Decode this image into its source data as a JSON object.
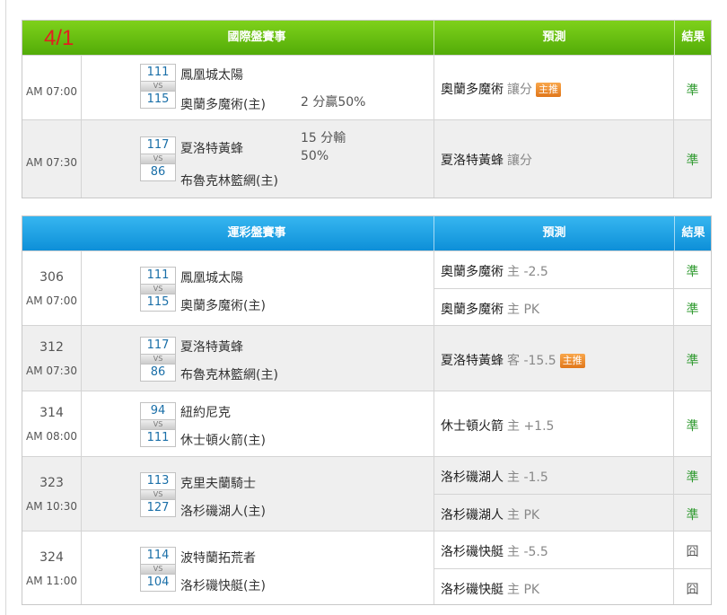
{
  "date_mark": "4/1",
  "colors": {
    "intl_header": "#5eb80e",
    "sports_header": "#1a9ee0",
    "badge": "#ef8a2c",
    "correct": "#2f9a2f",
    "score": "#1a6fa8",
    "date_mark": "#e02020"
  },
  "intl": {
    "header": {
      "title": "國際盤賽事",
      "prediction": "預測",
      "result": "結果"
    },
    "rows": [
      {
        "time": "AM 07:00",
        "away_score": "111",
        "home_score": "115",
        "vs": "VS",
        "away_team": "鳳凰城太陽",
        "home_team": "奧蘭多魔術(主)",
        "spread_line1": "2 分贏50%",
        "spread_line2": "",
        "pick_team": "奧蘭多魔術",
        "pick_type": "讓分",
        "badge": "主推",
        "result": "準"
      },
      {
        "time": "AM 07:30",
        "away_score": "117",
        "home_score": "86",
        "vs": "VS",
        "away_team": "夏洛特黃蜂",
        "home_team": "布魯克林籃網(主)",
        "spread_line1": "15 分輸",
        "spread_line2": "50%",
        "pick_team": "夏洛特黃蜂",
        "pick_type": "讓分",
        "badge": "",
        "result": "準"
      }
    ]
  },
  "sports": {
    "header": {
      "title": "運彩盤賽事",
      "prediction": "預測",
      "result": "結果"
    },
    "rows": [
      {
        "game_no": "306",
        "time": "AM 07:00",
        "away_score": "111",
        "home_score": "115",
        "vs": "VS",
        "away_team": "鳳凰城太陽",
        "home_team": "奧蘭多魔術(主)",
        "picks": [
          {
            "team": "奧蘭多魔術",
            "side": "主 -2.5",
            "badge": "",
            "result": "準"
          },
          {
            "team": "奧蘭多魔術",
            "side": "主 PK",
            "badge": "",
            "result": "準"
          }
        ]
      },
      {
        "game_no": "312",
        "time": "AM 07:30",
        "away_score": "117",
        "home_score": "86",
        "vs": "VS",
        "away_team": "夏洛特黃蜂",
        "home_team": "布魯克林籃網(主)",
        "picks": [
          {
            "team": "夏洛特黃蜂",
            "side": "客 -15.5",
            "badge": "主推",
            "result": "準"
          }
        ]
      },
      {
        "game_no": "314",
        "time": "AM 08:00",
        "away_score": "94",
        "home_score": "111",
        "vs": "VS",
        "away_team": "紐約尼克",
        "home_team": "休士頓火箭(主)",
        "picks": [
          {
            "team": "休士頓火箭",
            "side": "主 +1.5",
            "badge": "",
            "result": "準"
          }
        ]
      },
      {
        "game_no": "323",
        "time": "AM 10:30",
        "away_score": "113",
        "home_score": "127",
        "vs": "VS",
        "away_team": "克里夫蘭騎士",
        "home_team": "洛杉磯湖人(主)",
        "picks": [
          {
            "team": "洛杉磯湖人",
            "side": "主 -1.5",
            "badge": "",
            "result": "準"
          },
          {
            "team": "洛杉磯湖人",
            "side": "主 PK",
            "badge": "",
            "result": "準"
          }
        ]
      },
      {
        "game_no": "324",
        "time": "AM 11:00",
        "away_score": "114",
        "home_score": "104",
        "vs": "VS",
        "away_team": "波特蘭拓荒者",
        "home_team": "洛杉磯快艇(主)",
        "picks": [
          {
            "team": "洛杉磯快艇",
            "side": "主 -5.5",
            "badge": "",
            "result": "囧"
          },
          {
            "team": "洛杉磯快艇",
            "side": "主 PK",
            "badge": "",
            "result": "囧"
          }
        ]
      }
    ]
  }
}
